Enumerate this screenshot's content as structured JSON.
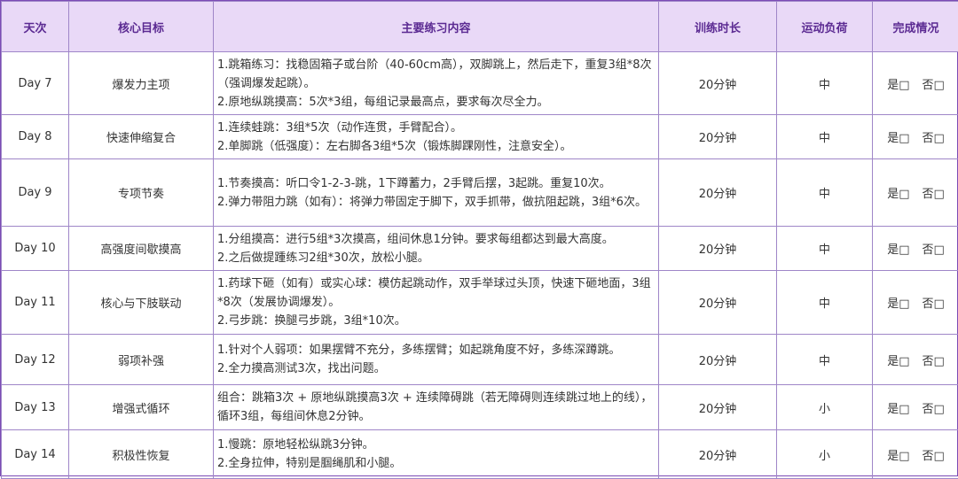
{
  "headers": [
    "天次",
    "核心目标",
    "主要练习内容",
    "训练时长",
    "运动负荷",
    "完成情况"
  ],
  "rows": [
    {
      "day": "Day 7",
      "goal": "爆发力主项",
      "content": [
        "1.跳箱练习：找稳固箱子或台阶（40-60cm高），双脚跳上，然后走下，重复3组*8次（强调爆发起跳）。",
        "2.原地纵跳摸高：5次*3组，每组记录最高点，要求每次尽全力。"
      ],
      "duration": "20分钟",
      "load": "中",
      "yes": "是□",
      "no": "否□"
    },
    {
      "day": "Day 8",
      "goal": "快速伸缩复合",
      "content": [
        "1.连续蛙跳：3组*5次（动作连贯，手臂配合）。",
        "2.单脚跳（低强度）：左右脚各3组*5次（锻炼脚踝刚性，注意安全）。"
      ],
      "duration": "20分钟",
      "load": "中",
      "yes": "是□",
      "no": "否□"
    },
    {
      "day": "Day 9",
      "goal": "专项节奏",
      "content": [
        "1.节奏摸高：听口令1-2-3-跳，1下蹲蓄力，2手臂后摆，3起跳。重复10次。",
        "2.弹力带阻力跳（如有）：将弹力带固定于脚下，双手抓带，做抗阻起跳，3组*6次。"
      ],
      "duration": "20分钟",
      "load": "中",
      "yes": "是□",
      "no": "否□"
    },
    {
      "day": "Day 10",
      "goal": "高强度间歇摸高",
      "content": [
        "1.分组摸高：进行5组*3次摸高，组间休息1分钟。要求每组都达到最大高度。",
        "2.之后做提踵练习2组*30次，放松小腿。"
      ],
      "duration": "20分钟",
      "load": "中",
      "yes": "是□",
      "no": "否□"
    },
    {
      "day": "Day 11",
      "goal": "核心与下肢联动",
      "content": [
        "1.药球下砸（如有）或实心球：模仿起跳动作，双手举球过头顶，快速下砸地面，3组*8次（发展协调爆发）。",
        "2.弓步跳：换腿弓步跳，3组*10次。"
      ],
      "duration": "20分钟",
      "load": "中",
      "yes": "是□",
      "no": "否□"
    },
    {
      "day": "Day 12",
      "goal": "弱项补强",
      "content": [
        "1.针对个人弱项：如果摆臂不充分，多练摆臂；如起跳角度不好，多练深蹲跳。",
        "2.全力摸高测试3次，找出问题。"
      ],
      "duration": "20分钟",
      "load": "中",
      "yes": "是□",
      "no": "否□"
    },
    {
      "day": "Day 13",
      "goal": "增强式循环",
      "content": [
        "组合：跳箱3次 + 原地纵跳摸高3次 + 连续障碍跳（若无障碍则连续跳过地上的线），循环3组，每组间休息2分钟。"
      ],
      "duration": "20分钟",
      "load": "小",
      "yes": "是□",
      "no": "否□"
    },
    {
      "day": "Day 14",
      "goal": "积极性恢复",
      "content": [
        "1.慢跳：原地轻松纵跳3分钟。",
        "2.全身拉伸，特别是腘绳肌和小腿。"
      ],
      "duration": "20分钟",
      "load": "小",
      "yes": "是□",
      "no": "否□"
    }
  ]
}
